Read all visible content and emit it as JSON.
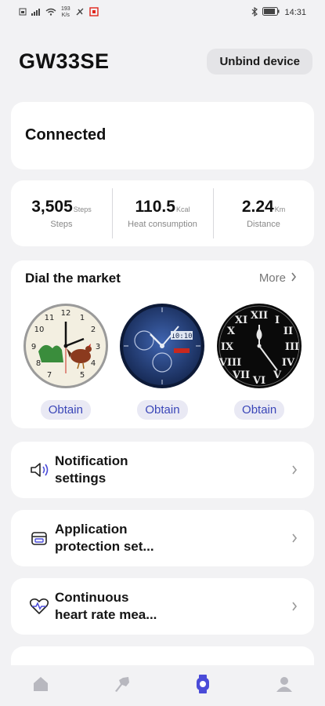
{
  "status_bar": {
    "network_speed": "193",
    "network_speed_unit": "K/s",
    "time": "14:31"
  },
  "header": {
    "title": "GW33SE",
    "unbind_label": "Unbind device"
  },
  "connection": {
    "status": "Connected"
  },
  "stats": [
    {
      "value": "3,505",
      "unit": "Steps",
      "label": "Steps"
    },
    {
      "value": "110.5",
      "unit": "Kcal",
      "label": "Heat consumption"
    },
    {
      "value": "2.24",
      "unit": "Km",
      "label": "Distance"
    }
  ],
  "dial_market": {
    "title": "Dial the market",
    "more_label": "More",
    "items": [
      {
        "button": "Obtain",
        "style": "cream-animals"
      },
      {
        "button": "Obtain",
        "style": "blue-sport"
      },
      {
        "button": "Obtain",
        "style": "black-roman"
      }
    ],
    "blue_dial_time": "10:10"
  },
  "menu": [
    {
      "label": "Notification\nsettings",
      "icon": "speaker-icon"
    },
    {
      "label": "Application\nprotection set...",
      "icon": "app-protection-icon"
    },
    {
      "label": "Continuous\nheart rate mea...",
      "icon": "heart-rate-icon"
    }
  ],
  "bottom_nav": [
    {
      "icon": "home-icon",
      "active": false
    },
    {
      "icon": "sport-icon",
      "active": false
    },
    {
      "icon": "watch-icon",
      "active": true
    },
    {
      "icon": "profile-icon",
      "active": false
    }
  ],
  "colors": {
    "accent": "#3a46b8",
    "active_nav": "#4a4bd8",
    "inactive_nav": "#b8b8bf",
    "background": "#f2f2f4"
  }
}
